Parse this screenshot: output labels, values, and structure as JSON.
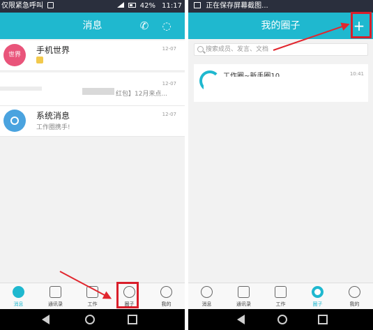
{
  "left_screen": {
    "status_bar": {
      "carrier": "仅限紧急呼叫",
      "battery": "42%",
      "time": "11:17"
    },
    "title": "消息",
    "messages": [
      {
        "avatar_text": "世界",
        "avatar_color": "#e9547a",
        "name": "手机世界",
        "time": "12-07",
        "preview": ""
      },
      {
        "avatar_text": "",
        "avatar_color": "#ffffff",
        "name": "",
        "time": "12-07",
        "preview": "红包】12月来点..."
      },
      {
        "avatar_text": "",
        "avatar_color": "#4aa3df",
        "name": "系统消息",
        "time": "12-07",
        "preview": "工作圈携手!"
      }
    ],
    "tabs": [
      "消息",
      "通讯录",
      "工作",
      "圈子",
      "我的"
    ]
  },
  "right_screen": {
    "status_bar": {
      "notice": "正在保存屏幕截图..."
    },
    "title": "我的圈子",
    "add_button": "+",
    "search_placeholder": "搜索成员、发言、文档",
    "circles": [
      {
        "name": "工作圈~新手圈10",
        "time": "10:41"
      }
    ],
    "tabs": [
      "消息",
      "通讯录",
      "工作",
      "圈子",
      "我的"
    ]
  },
  "colors": {
    "brand": "#1fb8cf",
    "highlight": "#d91e2a",
    "status_bar": "#2a2f3d"
  }
}
